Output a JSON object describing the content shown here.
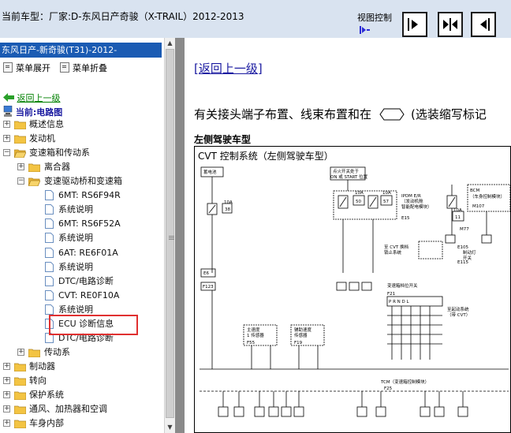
{
  "header": {
    "title": "当前车型：厂家:D-东风日产奇骏（X-TRAIL）2012-2013",
    "view_control_label": "视图控制"
  },
  "sidebar": {
    "brand": "东风日产-新奇骏(T31)-2012-",
    "expand_label": "菜单展开",
    "collapse_label": "菜单折叠",
    "back_label": "返回上一级",
    "current_label": "当前:电路图",
    "tree": [
      {
        "label": "概述信息"
      },
      {
        "label": "发动机"
      },
      {
        "label": "变速箱和传动系"
      },
      {
        "label": "离合器"
      },
      {
        "label": "变速驱动桥和变速箱"
      },
      {
        "label": "6MT: RS6F94R"
      },
      {
        "label": "系统说明"
      },
      {
        "label": "6MT: RS6F52A"
      },
      {
        "label": "系统说明"
      },
      {
        "label": "6AT: RE6F01A"
      },
      {
        "label": "系统说明"
      },
      {
        "label": "DTC/电路诊断"
      },
      {
        "label": "CVT: RE0F10A"
      },
      {
        "label": "系统说明"
      },
      {
        "label": "ECU 诊断信息"
      },
      {
        "label": "DTC/电路诊断"
      },
      {
        "label": "传动系"
      },
      {
        "label": "制动器"
      },
      {
        "label": "转向"
      },
      {
        "label": "保护系统"
      },
      {
        "label": "通风、加热器和空调"
      },
      {
        "label": "车身内部"
      }
    ]
  },
  "content": {
    "return_link": "[返回上一级]",
    "description": "有关接头端子布置、线束布置和在",
    "description_tail": "(选装缩写标记",
    "subheading": "左侧驾驶车型",
    "diagram": {
      "title": "CVT 控制系统（左侧驾驶车型）",
      "labels": {
        "battery": "蓄电池",
        "ign1": "点火开关处于",
        "ign2": "ON 或 START 位置",
        "ipdm1": "IPDM E/R",
        "ipdm2": "（发动机舱",
        "ipdm3": "智能配电模块）",
        "bcm1": "BCM",
        "bcm2": "（车身控制模块）",
        "cvt1": "至 CVT 换档",
        "cvt2": "锁止系统",
        "brake1": "制动灯",
        "brake2": "开关",
        "range1": "变速箱档位开关",
        "start1": "至起动系统",
        "start2": "（带 CVT）",
        "spd1a": "主速度",
        "spd1b": "1 传感器",
        "spd2a": "辅助速度",
        "spd2b": "传感器",
        "tcm": "TCM（变速箱控制模块）",
        "f10a1": "10A",
        "f38": "38",
        "f10a2": "10A",
        "f50": "50",
        "f10a3": "10A",
        "f57": "57",
        "f10a4": "10A",
        "f11": "11",
        "c_e15": "E15",
        "c_m107": "M107",
        "c_m77": "M77",
        "c_e105": "E105",
        "c_e115": "E115",
        "c_e6": "E6",
        "c_f123": "F123",
        "c_f21": "F21",
        "c_f55": "F55",
        "c_f19": "F19",
        "c_f25": "F25",
        "p_r_n_d_l": "P R N D L"
      }
    }
  }
}
